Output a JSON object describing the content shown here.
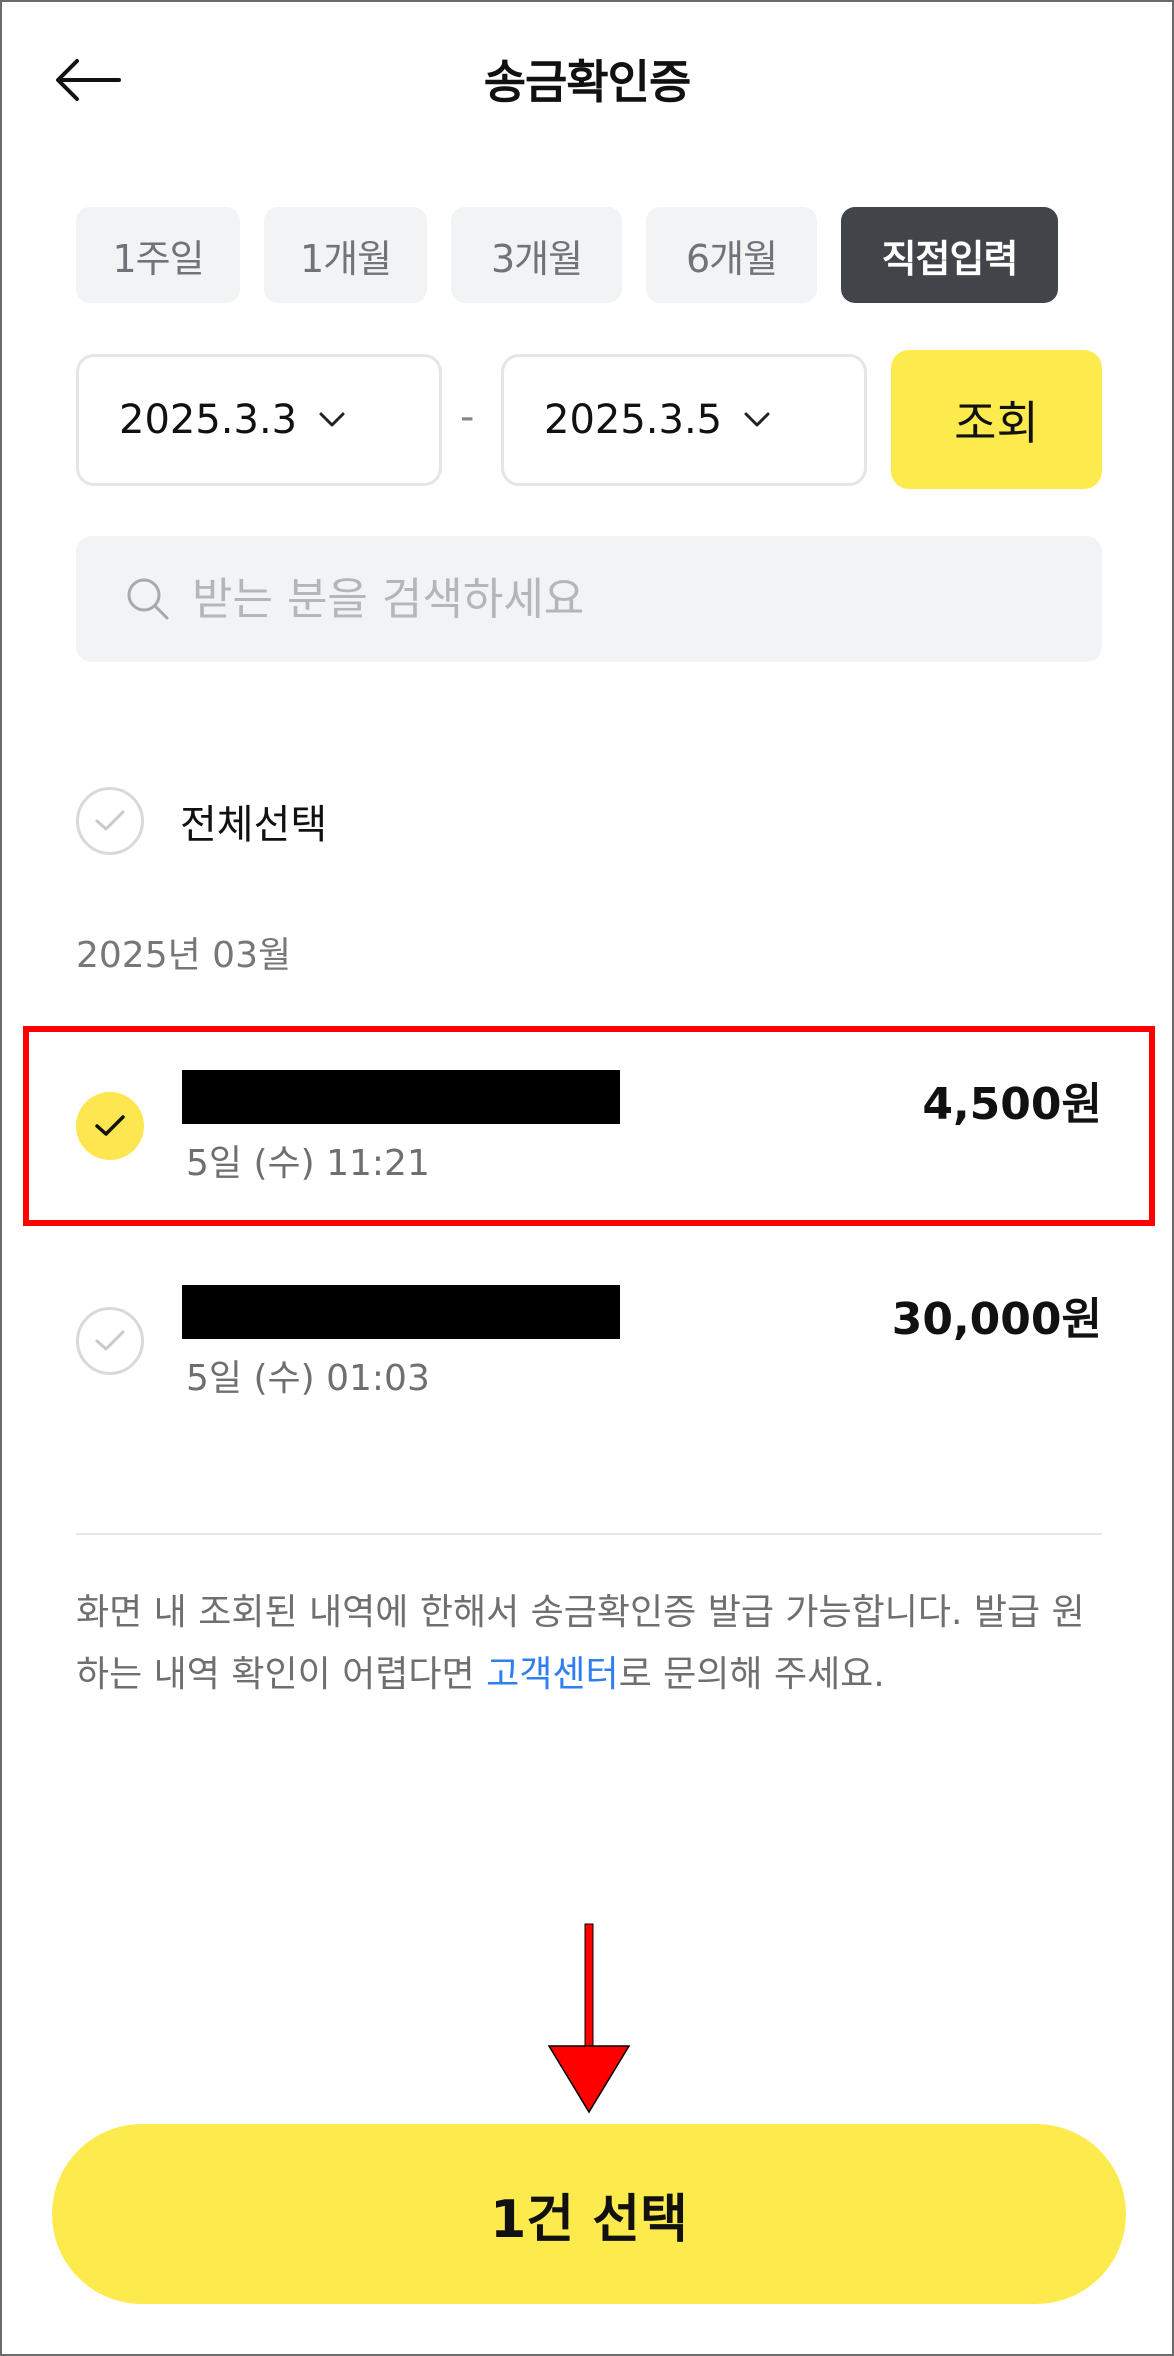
{
  "header": {
    "title": "송금확인증"
  },
  "period_chips": [
    {
      "label": "1주일",
      "active": false
    },
    {
      "label": "1개월",
      "active": false
    },
    {
      "label": "3개월",
      "active": false
    },
    {
      "label": "6개월",
      "active": false
    },
    {
      "label": "직접입력",
      "active": true
    }
  ],
  "date_range": {
    "start": "2025.3.3",
    "separator": "-",
    "end": "2025.3.5"
  },
  "query_button": "조회",
  "search": {
    "placeholder": "받는 분을 검색하세요",
    "value": ""
  },
  "select_all_label": "전체선택",
  "month_label": "2025년 03월",
  "transactions": [
    {
      "time": "5일 (수) 11:21",
      "amount": "4,500원",
      "checked": true
    },
    {
      "time": "5일 (수) 01:03",
      "amount": "30,000원",
      "checked": false
    }
  ],
  "notice": {
    "before_link": "화면 내 조회된 내역에 한해서 송금확인증 발급 가능합니다. 발급 원하는 내역 확인이 어렵다면 ",
    "link": "고객센터",
    "after_link": "로 문의해 주세요."
  },
  "primary_button": "1건 선택",
  "colors": {
    "accent": "#fdeb4d",
    "active_chip": "#414549",
    "link": "#2f7ef2",
    "annotation": "#ff0000"
  }
}
